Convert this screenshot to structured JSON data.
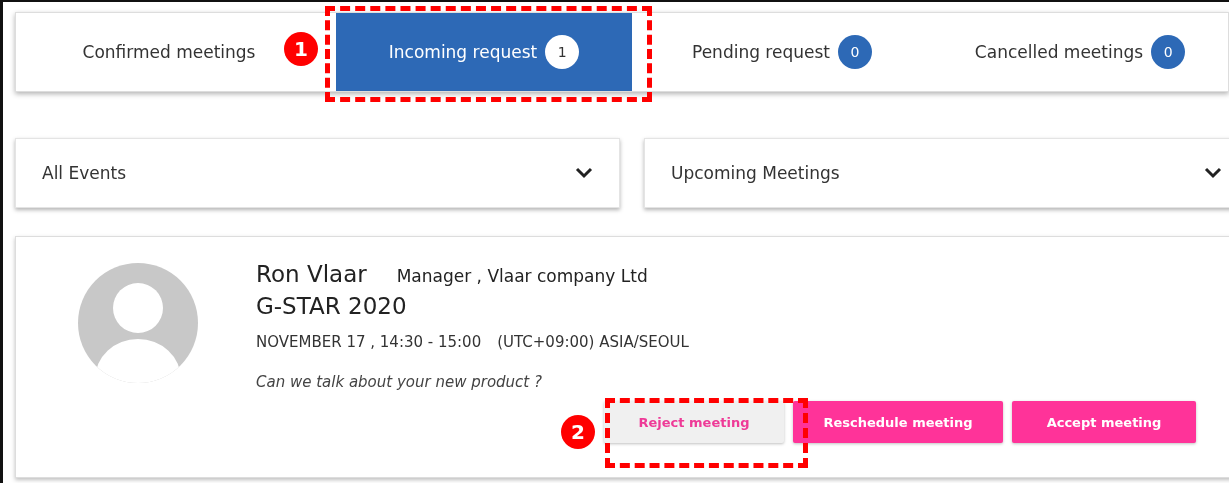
{
  "tabs": [
    {
      "label": "Confirmed meetings",
      "selected": false
    },
    {
      "label": "Incoming request",
      "count": "1",
      "selected": true
    },
    {
      "label": "Pending request",
      "count": "0",
      "selected": false
    },
    {
      "label": "Cancelled meetings",
      "count": "0",
      "selected": false
    }
  ],
  "filters": [
    {
      "value": "All Events"
    },
    {
      "value": "Upcoming Meetings"
    }
  ],
  "meeting": {
    "name": "Ron Vlaar",
    "role": "Manager , Vlaar company Ltd",
    "event": "G-STAR 2020",
    "time": "NOVEMBER 17 , 14:30 - 15:00",
    "timezone": "(UTC+09:00) ASIA/SEOUL",
    "message": "Can we talk about your new product ?",
    "buttons": [
      {
        "label": "Reject meeting",
        "kind": "secondary"
      },
      {
        "label": "Reschedule meeting",
        "kind": "primary"
      },
      {
        "label": "Accept meeting",
        "kind": "primary"
      }
    ]
  },
  "callouts": [
    {
      "number": "1"
    },
    {
      "number": "2"
    }
  ]
}
